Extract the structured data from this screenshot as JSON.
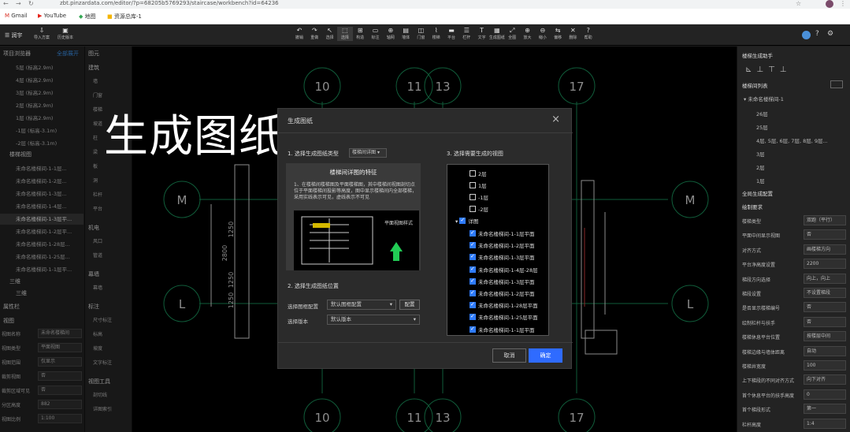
{
  "browser": {
    "url": "zbt.pinzardata.com/editor/?p=68205b5769293/staircase/workbench?id=64236",
    "bookmarks": [
      "Gmail",
      "YouTube",
      "地图",
      "资源总库-1"
    ]
  },
  "app": {
    "project_name": "润宇",
    "top_actions": [
      "导入方案",
      "历史版本"
    ],
    "tools": [
      "撤销",
      "重做",
      "选择",
      "选择",
      "构造",
      "标注",
      "轴网",
      "墙体",
      "门窗",
      "楼梯",
      "平台",
      "栏杆",
      "文字",
      "生成图纸",
      "全图",
      "放大",
      "缩小",
      "偏移",
      "删除",
      "帮助"
    ]
  },
  "left_panel": {
    "title": "项目浏览器",
    "collapse_label": "全部展开",
    "floors": [
      "5层 (标高2.9m)",
      "4层 (标高2.9m)",
      "3层 (标高2.9m)",
      "2层 (标高2.9m)",
      "1层 (标高2.9m)",
      "-1层 (标高-3.1m)",
      "-2层 (标高-3.1m)"
    ],
    "stair_group_title": "楼梯视图",
    "stairs": [
      "未命名楼梯间-1-1层...",
      "未命名楼梯间-1-2层...",
      "未命名楼梯间-1-3层...",
      "未命名楼梯间-1-4层...",
      "未命名楼梯间-1-3层平...",
      "未命名楼梯间-1-2层平...",
      "未命名楼梯间-1-28层...",
      "未命名楼梯间-1-25层...",
      "未命名楼梯间-1-1层平..."
    ],
    "extra": [
      "三维",
      "三维"
    ],
    "props_title": "属性栏",
    "view_title": "视图",
    "props": [
      {
        "k": "视图名称",
        "v": "未命名楼梯间"
      },
      {
        "k": "视图类型",
        "v": "平面视图"
      },
      {
        "k": "视图范围",
        "v": "仅显示"
      },
      {
        "k": "裁剪视图",
        "v": "否"
      },
      {
        "k": "裁剪区域可见",
        "v": "否"
      },
      {
        "k": "分区高度",
        "v": "882"
      },
      {
        "k": "视图比例",
        "v": "1:100"
      }
    ]
  },
  "component_panel": {
    "title": "图元",
    "sections": [
      {
        "name": "建筑",
        "items": [
          "墙",
          "门窗",
          "楼梯",
          "坡道",
          "柱",
          "梁",
          "板",
          "洞",
          "栏杆",
          "平台"
        ]
      },
      {
        "name": "机电",
        "items": [
          "风口",
          "管道"
        ]
      },
      {
        "name": "幕墙",
        "items": [
          "幕墙"
        ]
      },
      {
        "name": "标注",
        "items": [
          "尺寸标注",
          "标高",
          "坡度",
          "文字标注"
        ]
      },
      {
        "name": "视图工具",
        "items": [
          "剖切线",
          "详图索引"
        ]
      }
    ]
  },
  "canvas": {
    "axis_labels_top": [
      "10",
      "11",
      "13",
      "17"
    ],
    "axis_labels_bottom": [
      "10",
      "11",
      "13",
      "17"
    ],
    "axis_labels_side": [
      "M",
      "L"
    ],
    "dims": [
      "1250",
      "2800",
      "1250",
      "1250"
    ]
  },
  "overlay_caption": "生成图纸",
  "modal": {
    "title": "生成图纸",
    "section1_label": "1. 选择生成图纸类型",
    "section1_value": "楼梯间详图",
    "preview_title": "楼梯间详图的特征",
    "preview_desc": "1、在楼梯间楼梯图及平面楼梯图，其中楼梯间视图剖切点位于平面楼梯间投影等高度，图中显示楼梯间内全部楼梯，采用实线表示可见，虚线表示不可见",
    "preview_label": "平面视图样式",
    "section2_label": "2. 选择生成图纸位置",
    "frame_label": "选择图框配置",
    "frame_value": "默认图框配置",
    "config_btn": "配置",
    "version_label": "选择版本",
    "version_value": "默认版本",
    "section3_label": "3. 选择需要生成的视图",
    "floor_items": [
      "2层",
      "1层",
      "-1层",
      "-2层"
    ],
    "group_label": "详图",
    "checked_items": [
      "未命名楼梯间-1-1层平面",
      "未命名楼梯间-1-2层平面",
      "未命名楼梯间-1-3层平面",
      "未命名楼梯间-1-4层-28层",
      "未命名楼梯间-1-3层平面",
      "未命名楼梯间-1-2层平面",
      "未命名楼梯间-1-28层平面",
      "未命名楼梯间-1-25层平面",
      "未命名楼梯间-1-1层平面"
    ],
    "cancel": "取消",
    "confirm": "确定"
  },
  "right_panel": {
    "title": "楼梯生成助手",
    "list_title": "楼梯间列表",
    "stair_name": "未命名楼梯间-1",
    "floors": [
      "26层",
      "25层",
      "4层, 5层, 6层, 7层, 8层, 9层...",
      "3层",
      "2层",
      "1层"
    ],
    "config_title": "全局生成配置",
    "sub_title": "绘制要求",
    "fields": [
      {
        "k": "楼梯类型",
        "v": "双跑（平行）"
      },
      {
        "k": "平面中间显示视图",
        "v": "否"
      },
      {
        "k": "对齐方式",
        "v": "画楼梯方向"
      },
      {
        "k": "平台净高度设置",
        "v": "2200"
      },
      {
        "k": "梯段方向选择",
        "v": "向上，向上"
      },
      {
        "k": "梯段设置",
        "v": "不设置梯段"
      },
      {
        "k": "是否显示楼梯编号",
        "v": "否"
      },
      {
        "k": "绘制栏杆与扶手",
        "v": "否"
      },
      {
        "k": "楼梯休息平台位置",
        "v": "按楼层中间"
      },
      {
        "k": "楼梯边缘与墙体距离",
        "v": "自动"
      },
      {
        "k": "楼梯井宽度",
        "v": "100"
      },
      {
        "k": "上下梯段的不同对齐方式",
        "v": "向下对齐"
      },
      {
        "k": "首个休息平台的扶手高度",
        "v": "0"
      },
      {
        "k": "首个梯段形式",
        "v": "第一"
      },
      {
        "k": "栏杆高度",
        "v": "1:4"
      }
    ]
  }
}
